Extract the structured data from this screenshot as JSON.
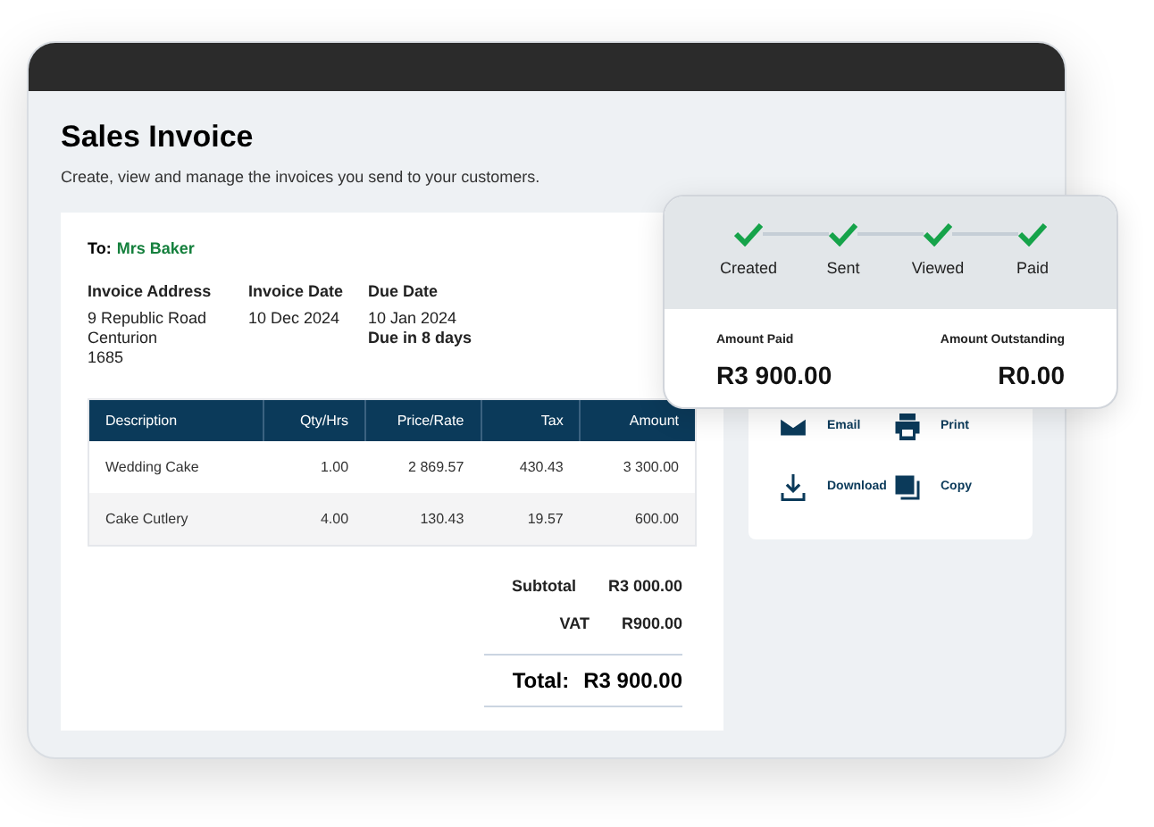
{
  "header": {
    "title": "Sales Invoice",
    "subtitle": "Create, view and manage the invoices you send to your customers."
  },
  "invoice": {
    "to_label": "To:",
    "recipient": "Mrs Baker",
    "address": {
      "label": "Invoice Address",
      "lines": [
        "9 Republic Road",
        "Centurion",
        "1685"
      ]
    },
    "invoice_date": {
      "label": "Invoice Date",
      "value": "10 Dec 2024"
    },
    "due_date": {
      "label": "Due Date",
      "value": "10 Jan 2024",
      "note": "Due in 8 days"
    },
    "table": {
      "columns": [
        "Description",
        "Qty/Hrs",
        "Price/Rate",
        "Tax",
        "Amount"
      ],
      "rows": [
        [
          "Wedding Cake",
          "1.00",
          "2 869.57",
          "430.43",
          "3 300.00"
        ],
        [
          "Cake Cutlery",
          "4.00",
          "130.43",
          "19.57",
          "600.00"
        ]
      ]
    },
    "totals": [
      {
        "label": "Subtotal",
        "value": "R3 000.00"
      },
      {
        "label": "VAT",
        "value": "R900.00"
      }
    ],
    "total": {
      "label": "Total:",
      "value": "R3 900.00"
    }
  },
  "actions": [
    {
      "kind": "email",
      "label": "Email"
    },
    {
      "kind": "print",
      "label": "Print"
    },
    {
      "kind": "download",
      "label": "Download"
    },
    {
      "kind": "copy",
      "label": "Copy"
    }
  ],
  "status": {
    "steps": [
      {
        "label": "Created",
        "done": true
      },
      {
        "label": "Sent",
        "done": true
      },
      {
        "label": "Viewed",
        "done": true
      },
      {
        "label": "Paid",
        "done": true
      }
    ],
    "paid": {
      "label": "Amount Paid",
      "value": "R3 900.00"
    },
    "outstanding": {
      "label": "Amount Outstanding",
      "value": "R0.00"
    }
  }
}
